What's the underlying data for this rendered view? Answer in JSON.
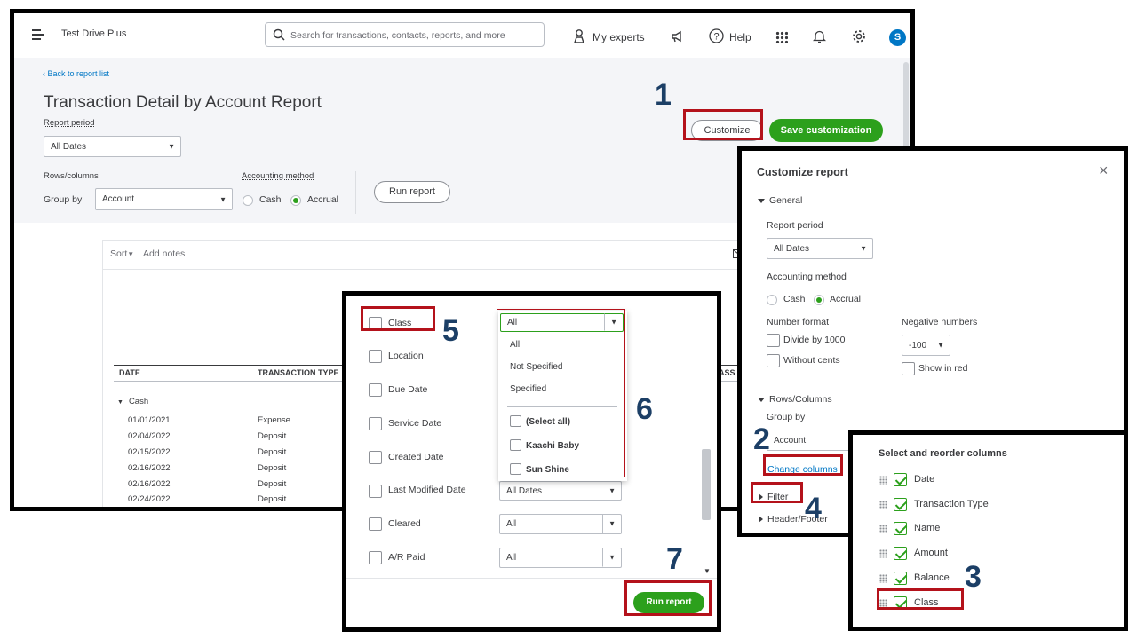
{
  "topbar": {
    "company": "Test Drive Plus",
    "search_placeholder": "Search for transactions, contacts, reports, and more",
    "my_experts": "My experts",
    "help": "Help",
    "avatar_letter": "S"
  },
  "report": {
    "back_link": "Back to report list",
    "title": "Transaction Detail by Account Report",
    "report_period_label": "Report period",
    "report_period_value": "All Dates",
    "rows_columns_label": "Rows/columns",
    "group_by_label": "Group by",
    "group_by_value": "Account",
    "accounting_method_label": "Accounting method",
    "cash": "Cash",
    "accrual": "Accrual",
    "run_report": "Run report",
    "customize": "Customize",
    "save_customization": "Save customization",
    "sort": "Sort",
    "add_notes": "Add notes",
    "columns": [
      "DATE",
      "TRANSACTION TYPE",
      "ASS"
    ],
    "group_name": "Cash",
    "rows": [
      {
        "date": "01/01/2021",
        "type": "Expense"
      },
      {
        "date": "02/04/2022",
        "type": "Deposit"
      },
      {
        "date": "02/15/2022",
        "type": "Deposit"
      },
      {
        "date": "02/16/2022",
        "type": "Deposit"
      },
      {
        "date": "02/16/2022",
        "type": "Deposit"
      },
      {
        "date": "02/24/2022",
        "type": "Deposit"
      }
    ]
  },
  "customize_panel": {
    "title": "Customize report",
    "general": "General",
    "report_period_label": "Report period",
    "report_period_value": "All Dates",
    "accounting_method_label": "Accounting method",
    "cash": "Cash",
    "accrual": "Accrual",
    "number_format_label": "Number format",
    "divide_by_1000": "Divide by 1000",
    "without_cents": "Without cents",
    "negative_numbers_label": "Negative numbers",
    "negative_numbers_value": "-100",
    "show_in_red": "Show in red",
    "rows_columns": "Rows/Columns",
    "group_by_label": "Group by",
    "group_by_value": "Account",
    "change_columns": "Change columns",
    "filter": "Filter",
    "header_footer": "Header/Footer"
  },
  "columns_panel": {
    "title": "Select and reorder columns",
    "items": [
      "Date",
      "Transaction Type",
      "Name",
      "Amount",
      "Balance",
      "Class"
    ]
  },
  "filter_panel": {
    "rows": [
      {
        "label": "Class",
        "value": "All"
      },
      {
        "label": "Location",
        "value": ""
      },
      {
        "label": "Due Date",
        "value": ""
      },
      {
        "label": "Service Date",
        "value": ""
      },
      {
        "label": "Created Date",
        "value": ""
      },
      {
        "label": "Last Modified Date",
        "value": "All Dates"
      },
      {
        "label": "Cleared",
        "value": "All"
      },
      {
        "label": "A/R Paid",
        "value": "All"
      }
    ],
    "dropdown_options": [
      "All",
      "Not Specified",
      "Specified"
    ],
    "dropdown_checks": [
      "(Select all)",
      "Kaachi Baby",
      "Sun Shine"
    ],
    "run_report": "Run report"
  },
  "steps": [
    "1",
    "2",
    "3",
    "4",
    "5",
    "6",
    "7"
  ],
  "colors": {
    "accent_green": "#2ca01c",
    "highlight_red": "#b4121b",
    "step_blue": "#1c3f66",
    "link_blue": "#0077c5"
  }
}
